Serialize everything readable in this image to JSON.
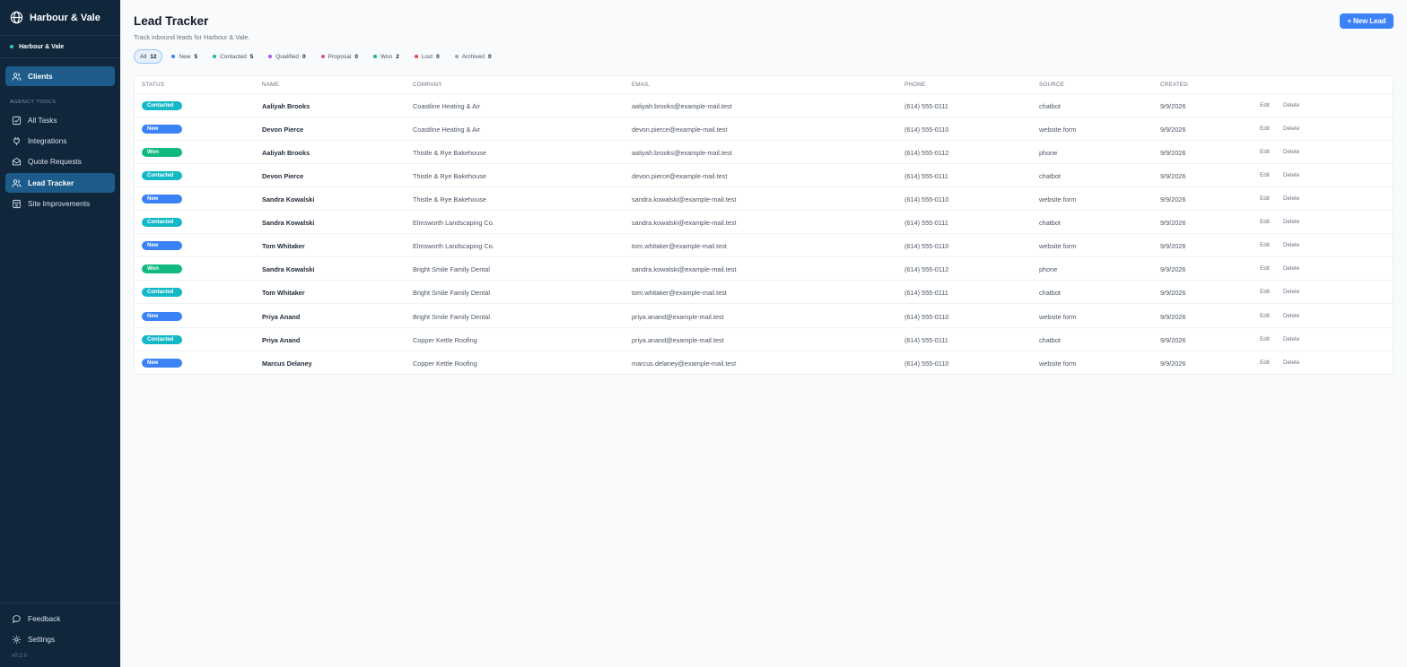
{
  "sidebar": {
    "brand": "Harbour & Vale",
    "workspace": "Harbour & Vale",
    "clients_label": "Clients",
    "section_label": "AGENCY TOOLS",
    "items": [
      {
        "label": "All Tasks",
        "icon": "checkbox-icon"
      },
      {
        "label": "Integrations",
        "icon": "plug-icon"
      },
      {
        "label": "Quote Requests",
        "icon": "envelope-icon"
      },
      {
        "label": "Lead Tracker",
        "icon": "users-icon",
        "active": true
      },
      {
        "label": "Site Improvements",
        "icon": "clipboard-icon"
      }
    ],
    "feedback_label": "Feedback",
    "settings_label": "Settings",
    "version": "v0.2.0"
  },
  "header": {
    "title": "Lead Tracker",
    "subtitle": "Track inbound leads for Harbour & Vale.",
    "new_lead_label": "+ New Lead"
  },
  "filters": [
    {
      "label": "All",
      "count": "12",
      "active": true,
      "color": ""
    },
    {
      "label": "New",
      "count": "5",
      "color": "#3b82f6"
    },
    {
      "label": "Contacted",
      "count": "5",
      "color": "#14b8a6"
    },
    {
      "label": "Qualified",
      "count": "0",
      "color": "#a855f7"
    },
    {
      "label": "Proposal",
      "count": "0",
      "color": "#e0527a"
    },
    {
      "label": "Won",
      "count": "2",
      "color": "#10b981"
    },
    {
      "label": "Lost",
      "count": "0",
      "color": "#ef4444"
    },
    {
      "label": "Archived",
      "count": "0",
      "color": "#9ca3af"
    }
  ],
  "status_colors": {
    "Contacted": "#14b8c6",
    "New": "#3b82f6",
    "Won": "#10b981"
  },
  "table": {
    "columns": [
      "STATUS",
      "NAME",
      "COMPANY",
      "EMAIL",
      "PHONE",
      "SOURCE",
      "CREATED"
    ],
    "edit_label": "Edit",
    "delete_label": "Delete",
    "rows": [
      {
        "status": "Contacted",
        "name": "Aaliyah Brooks",
        "company": "Coastline Heating & Air",
        "email": "aaliyah.brooks@example-mail.test",
        "phone": "(614) 555-0111",
        "source": "chatbot",
        "created": "9/9/2026"
      },
      {
        "status": "New",
        "name": "Devon Pierce",
        "company": "Coastline Heating & Air",
        "email": "devon.pierce@example-mail.test",
        "phone": "(614) 555-0110",
        "source": "website form",
        "created": "9/9/2026"
      },
      {
        "status": "Won",
        "name": "Aaliyah Brooks",
        "company": "Thistle & Rye Bakehouse",
        "email": "aaliyah.brooks@example-mail.test",
        "phone": "(614) 555-0112",
        "source": "phone",
        "created": "9/9/2026"
      },
      {
        "status": "Contacted",
        "name": "Devon Pierce",
        "company": "Thistle & Rye Bakehouse",
        "email": "devon.pierce@example-mail.test",
        "phone": "(614) 555-0111",
        "source": "chatbot",
        "created": "9/9/2026"
      },
      {
        "status": "New",
        "name": "Sandra Kowalski",
        "company": "Thistle & Rye Bakehouse",
        "email": "sandra.kowalski@example-mail.test",
        "phone": "(614) 555-0110",
        "source": "website form",
        "created": "9/9/2026"
      },
      {
        "status": "Contacted",
        "name": "Sandra Kowalski",
        "company": "Elmsworth Landscaping Co.",
        "email": "sandra.kowalski@example-mail.test",
        "phone": "(614) 555-0111",
        "source": "chatbot",
        "created": "9/9/2026"
      },
      {
        "status": "New",
        "name": "Tom Whitaker",
        "company": "Elmsworth Landscaping Co.",
        "email": "tom.whitaker@example-mail.test",
        "phone": "(614) 555-0110",
        "source": "website form",
        "created": "9/9/2026"
      },
      {
        "status": "Won",
        "name": "Sandra Kowalski",
        "company": "Bright Smile Family Dental",
        "email": "sandra.kowalski@example-mail.test",
        "phone": "(614) 555-0112",
        "source": "phone",
        "created": "9/9/2026"
      },
      {
        "status": "Contacted",
        "name": "Tom Whitaker",
        "company": "Bright Smile Family Dental",
        "email": "tom.whitaker@example-mail.test",
        "phone": "(614) 555-0111",
        "source": "chatbot",
        "created": "9/9/2026"
      },
      {
        "status": "New",
        "name": "Priya Anand",
        "company": "Bright Smile Family Dental",
        "email": "priya.anand@example-mail.test",
        "phone": "(614) 555-0110",
        "source": "website form",
        "created": "9/9/2026"
      },
      {
        "status": "Contacted",
        "name": "Priya Anand",
        "company": "Copper Kettle Roofing",
        "email": "priya.anand@example-mail.test",
        "phone": "(614) 555-0111",
        "source": "chatbot",
        "created": "9/9/2026"
      },
      {
        "status": "New",
        "name": "Marcus Delaney",
        "company": "Copper Kettle Roofing",
        "email": "marcus.delaney@example-mail.test",
        "phone": "(614) 555-0110",
        "source": "website form",
        "created": "9/9/2026"
      }
    ]
  }
}
